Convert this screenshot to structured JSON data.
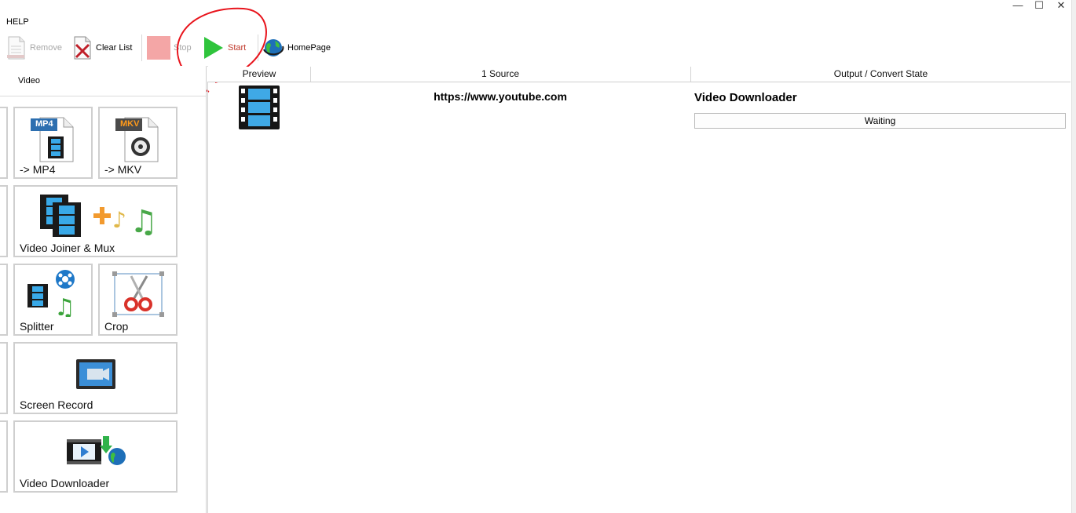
{
  "window": {
    "controls": {
      "minimize": "—",
      "maximize": "☐",
      "close": "✕"
    }
  },
  "menu": {
    "help": "HELP"
  },
  "toolbar": {
    "remove_label": "Remove",
    "clear_list_label": "Clear List",
    "stop_label": "Stop",
    "start_label": "Start",
    "homepage_label": "HomePage"
  },
  "left_panel": {
    "tab_label": "Video",
    "tiles": [
      {
        "label": "-> MP4",
        "badge": "MP4",
        "icon": "mp4-file-icon"
      },
      {
        "label": "-> MKV",
        "badge": "MKV",
        "icon": "mkv-file-icon"
      },
      {
        "label": "Video Joiner & Mux",
        "icon": "video-joiner-icon"
      },
      {
        "label": "Splitter",
        "icon": "splitter-icon"
      },
      {
        "label": "Crop",
        "icon": "crop-icon"
      },
      {
        "label": "Screen Record",
        "icon": "screen-record-icon"
      },
      {
        "label": "Video Downloader",
        "icon": "video-downloader-icon"
      }
    ]
  },
  "table": {
    "columns": [
      "Preview",
      "1 Source",
      "Output / Convert State"
    ],
    "rows": [
      {
        "preview_icon": "film-strip-icon",
        "source": "https://www.youtube.com",
        "output_title": "Video Downloader",
        "state": "Waiting"
      }
    ]
  },
  "colors": {
    "annotation_red": "#e8141c",
    "start_green": "#2fc43c",
    "stop_red": "#f2a8a8",
    "start_text": "#c0392b"
  }
}
